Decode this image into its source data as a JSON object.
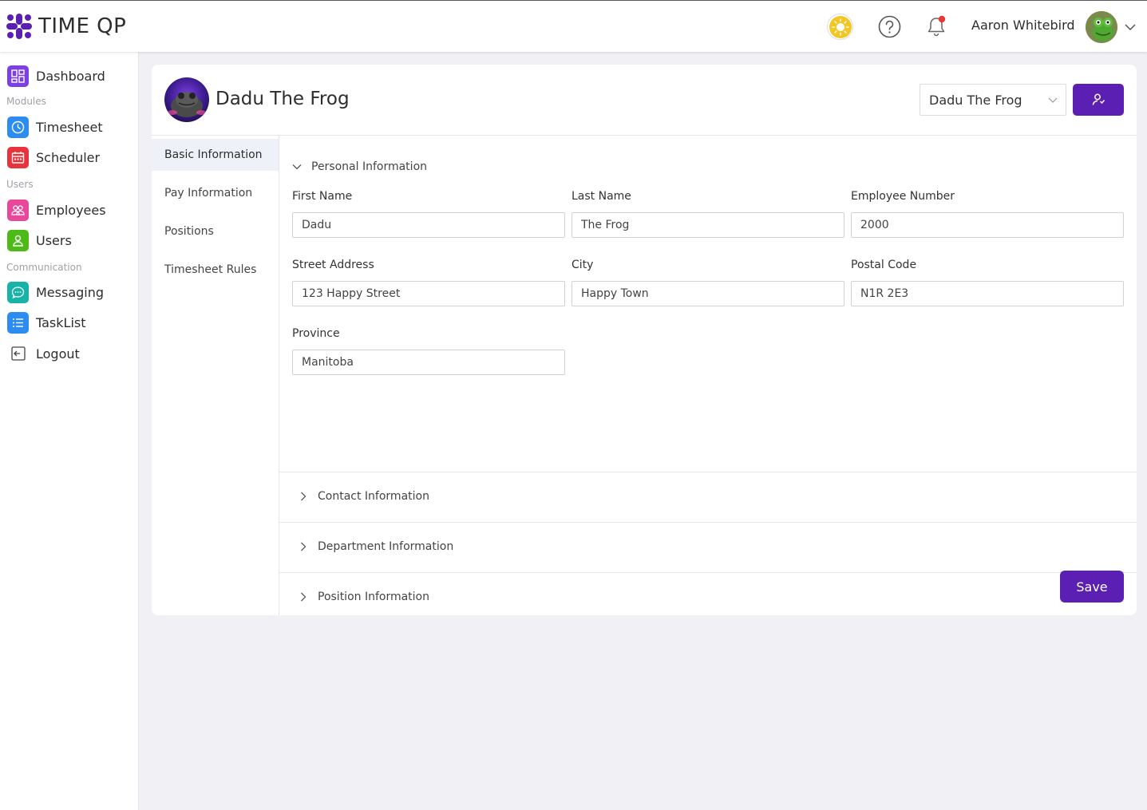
{
  "app": {
    "name": "TIME QP"
  },
  "header": {
    "user_name": "Aaron Whitebird"
  },
  "sidebar": {
    "items": [
      {
        "label": "Dashboard",
        "icon": "dashboard-icon",
        "color": "#7b3fe4"
      },
      {
        "label": "Timesheet",
        "icon": "clock-icon",
        "color": "#2d8cf0"
      },
      {
        "label": "Scheduler",
        "icon": "calendar-icon",
        "color": "#e8323c"
      },
      {
        "label": "Employees",
        "icon": "group-icon",
        "color": "#e8479a"
      },
      {
        "label": "Users",
        "icon": "user-icon",
        "color": "#4cbb17"
      },
      {
        "label": "Messaging",
        "icon": "chat-icon",
        "color": "#18b3a8"
      },
      {
        "label": "TaskList",
        "icon": "list-icon",
        "color": "#2d8cf0"
      },
      {
        "label": "Logout",
        "icon": "logout-icon",
        "color": "#ffffff"
      }
    ],
    "sections": [
      "Modules",
      "Users",
      "Communication"
    ]
  },
  "employee": {
    "name": "Dadu The Frog",
    "selector_value": "Dadu The Frog"
  },
  "tabs": [
    "Basic Information",
    "Pay Information",
    "Positions",
    "Timesheet Rules"
  ],
  "sections": {
    "personal": "Personal Information",
    "contact": "Contact Information",
    "department": "Department Information",
    "position": "Position Information"
  },
  "fields": {
    "first_name": {
      "label": "First Name",
      "value": "Dadu"
    },
    "last_name": {
      "label": "Last Name",
      "value": "The Frog"
    },
    "employee_number": {
      "label": "Employee Number",
      "value": "2000"
    },
    "street": {
      "label": "Street Address",
      "value": "123 Happy Street"
    },
    "city": {
      "label": "City",
      "value": "Happy Town"
    },
    "postal": {
      "label": "Postal Code",
      "value": "N1R 2E3"
    },
    "province": {
      "label": "Province",
      "value": "Manitoba"
    }
  },
  "save_label": "Save",
  "colors": {
    "accent": "#5b1fb3"
  }
}
